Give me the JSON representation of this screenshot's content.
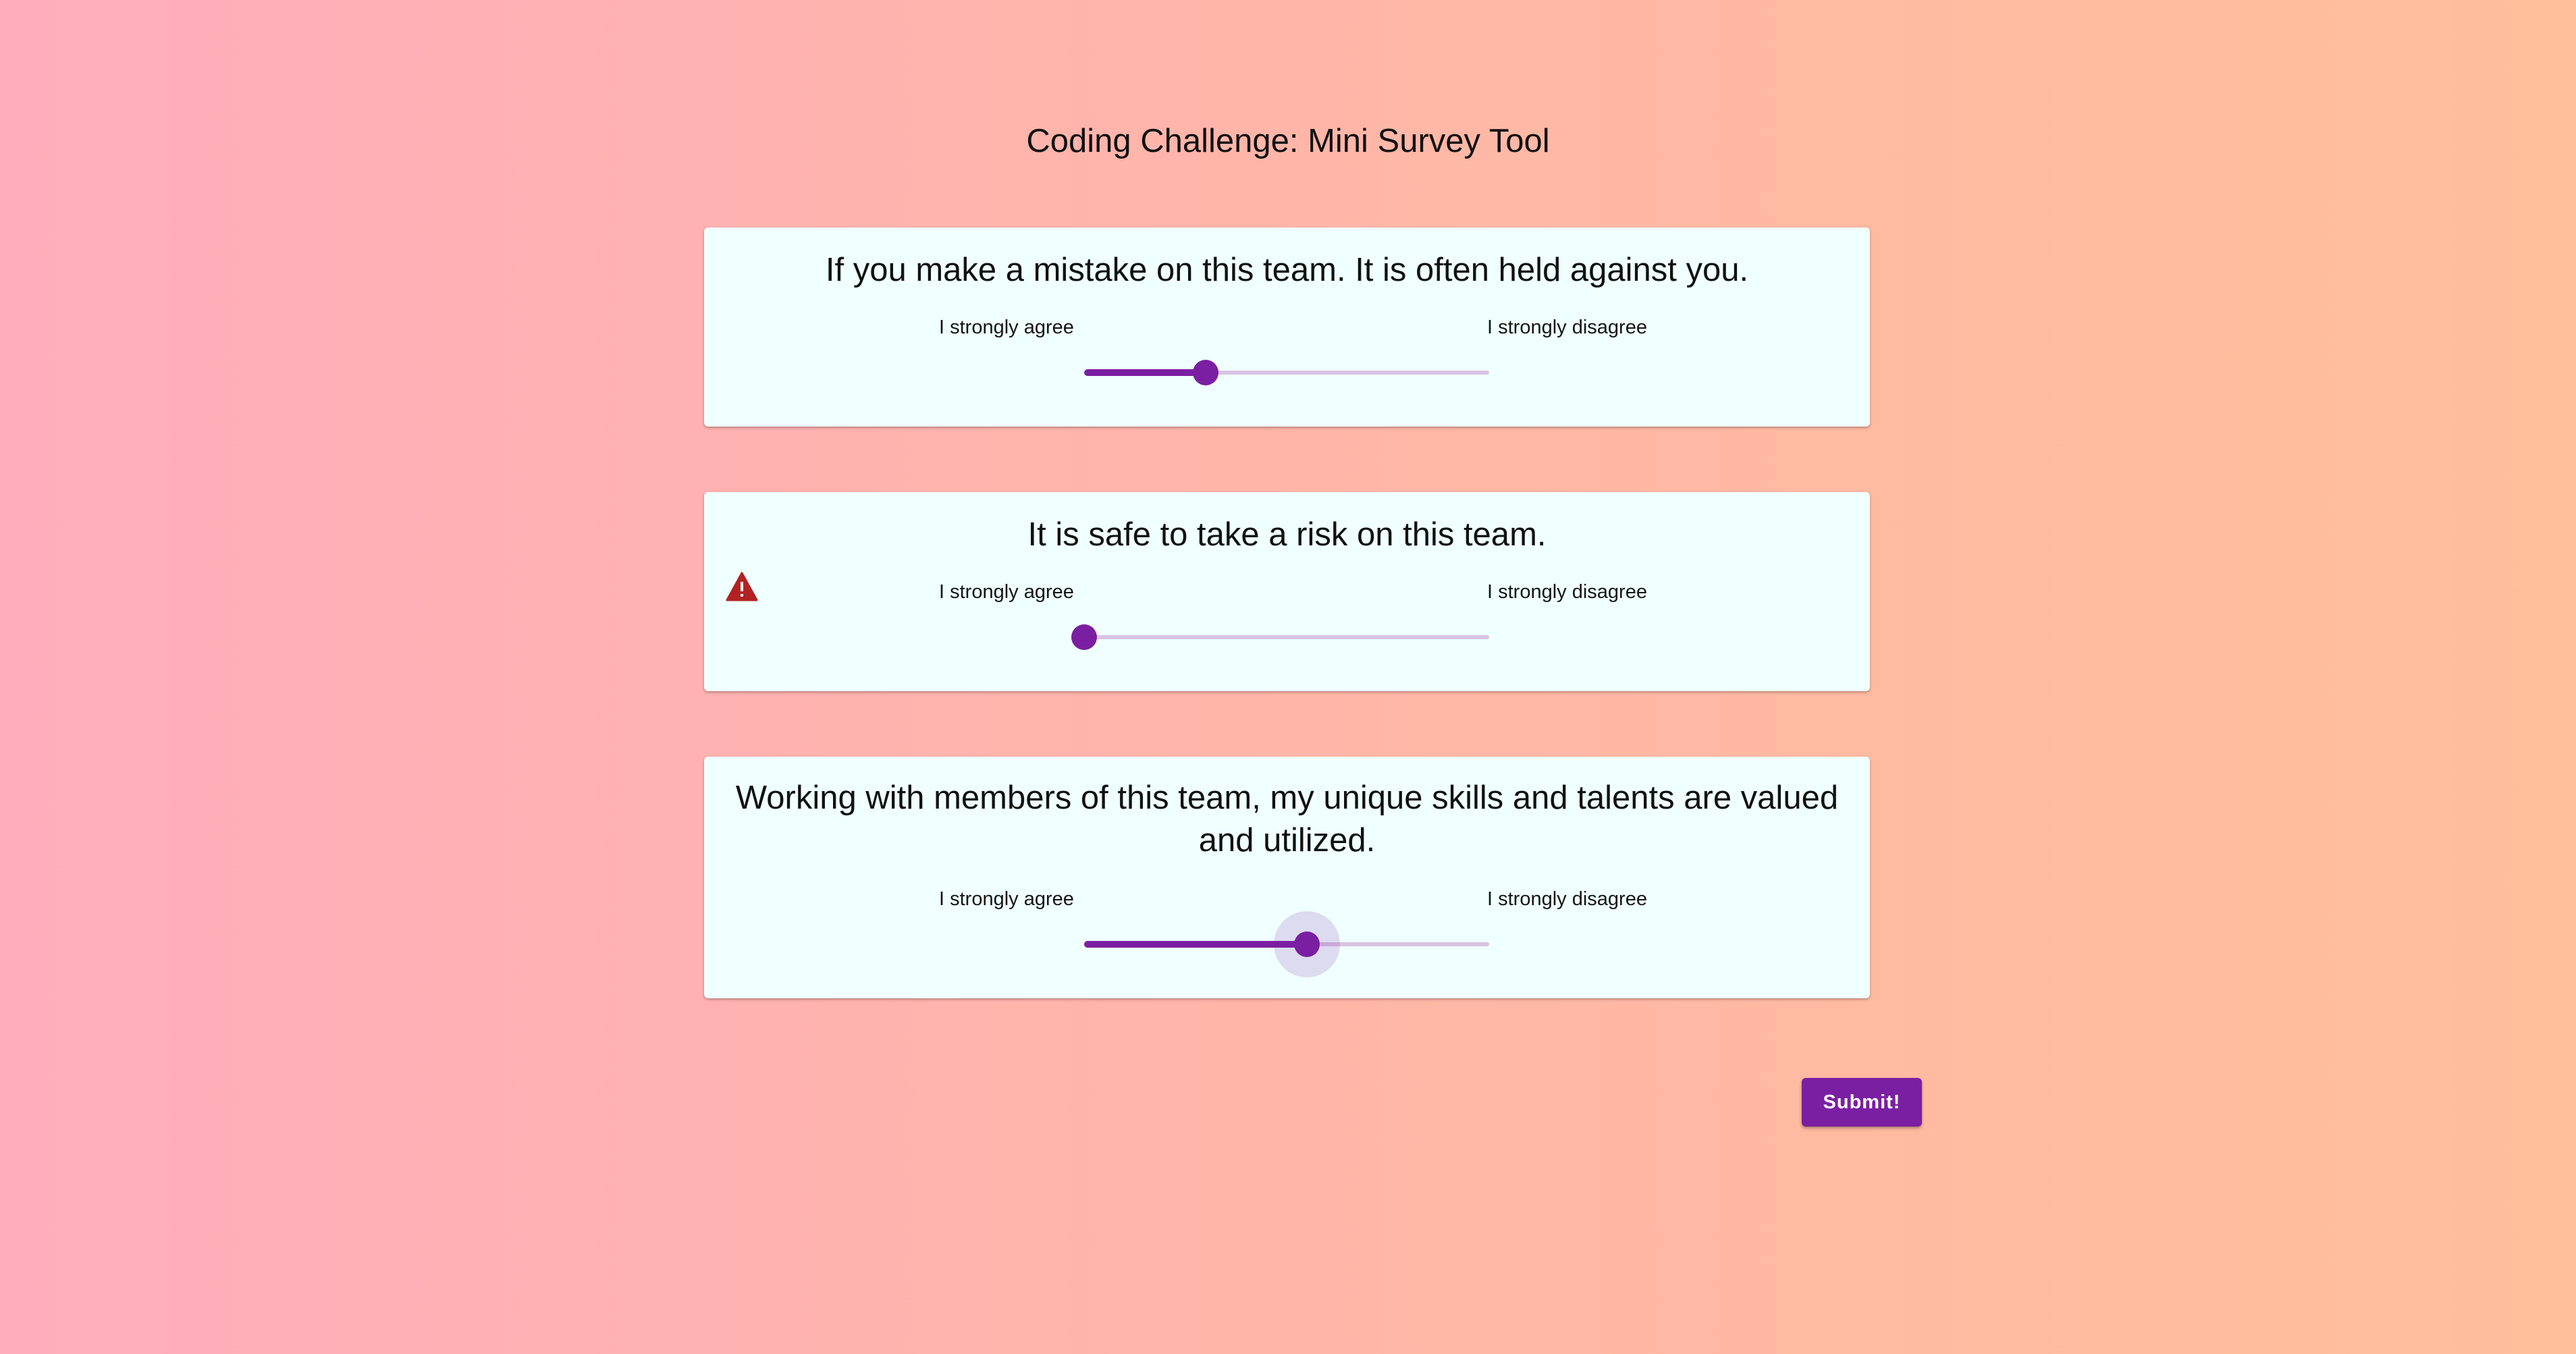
{
  "page": {
    "title": "Coding Challenge: Mini Survey Tool"
  },
  "questions": [
    {
      "text": "If you make a mistake on this team. It is often held against you.",
      "agree_label": "I strongly agree",
      "disagree_label": "I strongly disagree",
      "value_fraction": 0.3,
      "focused": false,
      "warning": false
    },
    {
      "text": "It is safe to take a risk on this team.",
      "agree_label": "I strongly agree",
      "disagree_label": "I strongly disagree",
      "value_fraction": 0.0,
      "focused": false,
      "warning": true,
      "warning_icon": "warning-triangle-icon"
    },
    {
      "text": "Working with members of this team, my unique skills and talents are valued and utilized.",
      "agree_label": "I strongly agree",
      "disagree_label": "I strongly disagree",
      "value_fraction": 0.55,
      "focused": true,
      "warning": false
    }
  ],
  "submit": {
    "label": "Submit!"
  },
  "colors": {
    "accent": "#7b1fa2",
    "track_inactive": "#d8c3e3",
    "card_background": "#f0ffff",
    "warning": "#b22222"
  }
}
